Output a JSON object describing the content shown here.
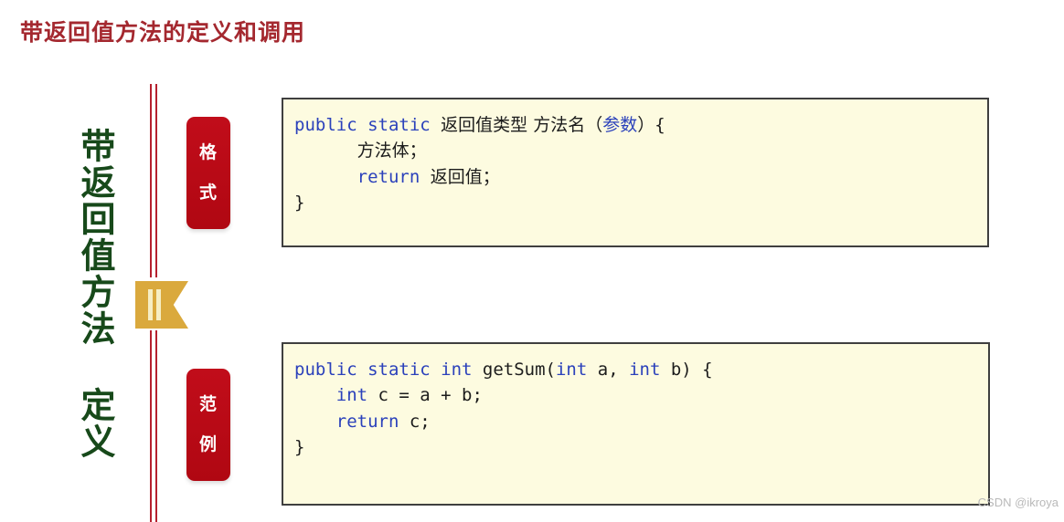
{
  "slide": {
    "title": "带返回值方法的定义和调用",
    "title_color": "#a4282f",
    "background_color": "#ffffff"
  },
  "vertical_label": {
    "text": "带返回值方法 定义",
    "color": "#17491a"
  },
  "ribbon": {
    "name": "gold-ribbon-divider",
    "fill_color": "#daa93d",
    "stripe_color": "#f6eec4"
  },
  "badges": [
    {
      "id": "format",
      "text_line1": "格",
      "text_line2": "式",
      "color": "#bb0a17",
      "text_color": "#ffffff"
    },
    {
      "id": "example",
      "text_line1": "范",
      "text_line2": "例",
      "color": "#bb0a17",
      "text_color": "#ffffff"
    }
  ],
  "code_blocks": [
    {
      "id": "format-syntax",
      "background_color": "#fdfbe0",
      "border_color": "#3f3f3f",
      "keyword_color": "#2b41bb",
      "lines": [
        {
          "segments": [
            {
              "text": "public static ",
              "type": "keyword"
            },
            {
              "text": "返回值类型 方法名（",
              "type": "cjk"
            },
            {
              "text": "参数",
              "type": "keyword-cjk"
            },
            {
              "text": "）",
              "type": "cjk"
            },
            {
              "text": "{",
              "type": "plain"
            }
          ]
        },
        {
          "segments": [
            {
              "text": "      ",
              "type": "plain"
            },
            {
              "text": "方法体；",
              "type": "cjk"
            }
          ]
        },
        {
          "segments": [
            {
              "text": "      ",
              "type": "plain"
            },
            {
              "text": "return ",
              "type": "keyword"
            },
            {
              "text": "返回值；",
              "type": "cjk"
            }
          ]
        },
        {
          "segments": [
            {
              "text": "}",
              "type": "plain"
            }
          ]
        }
      ]
    },
    {
      "id": "example-code",
      "background_color": "#fdfbe0",
      "border_color": "#3f3f3f",
      "keyword_color": "#2b41bb",
      "lines": [
        {
          "segments": [
            {
              "text": "public static int ",
              "type": "keyword"
            },
            {
              "text": "getSum(",
              "type": "plain"
            },
            {
              "text": "int",
              "type": "keyword"
            },
            {
              "text": " a, ",
              "type": "plain"
            },
            {
              "text": "int",
              "type": "keyword"
            },
            {
              "text": " b) {",
              "type": "plain"
            }
          ]
        },
        {
          "segments": [
            {
              "text": "    ",
              "type": "plain"
            },
            {
              "text": "int",
              "type": "keyword"
            },
            {
              "text": " c = a + b;",
              "type": "plain"
            }
          ]
        },
        {
          "segments": [
            {
              "text": "    ",
              "type": "plain"
            },
            {
              "text": "return",
              "type": "keyword"
            },
            {
              "text": " c;",
              "type": "plain"
            }
          ]
        },
        {
          "segments": [
            {
              "text": "}",
              "type": "plain"
            }
          ]
        }
      ]
    }
  ],
  "rules": {
    "color": "#b5202e",
    "count": 2
  },
  "watermark": {
    "text": "CSDN @ikroya",
    "color": "#b9b9b9"
  }
}
